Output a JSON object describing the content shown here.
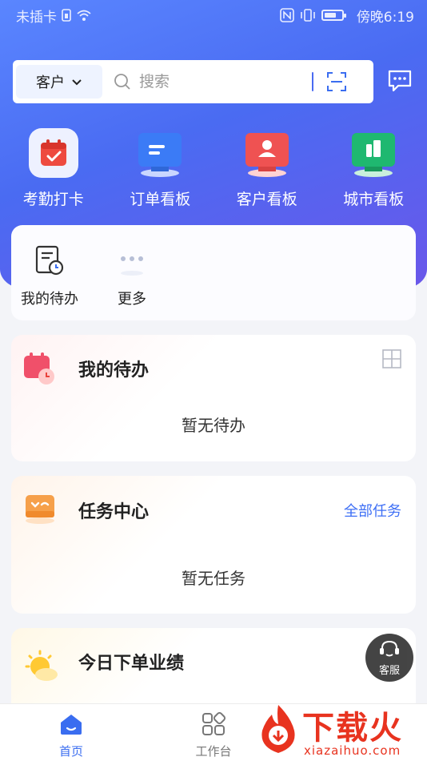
{
  "status_bar": {
    "carrier": "未插卡",
    "time": "傍晚6:19"
  },
  "search": {
    "scope_label": "客户",
    "placeholder": "搜索"
  },
  "quick_actions": [
    {
      "label": "考勤打卡",
      "icon": "calendar-check-icon",
      "color": "#e9423b"
    },
    {
      "label": "订单看板",
      "icon": "order-board-icon",
      "color": "#3b7bf6"
    },
    {
      "label": "客户看板",
      "icon": "customer-board-icon",
      "color": "#ef5252"
    },
    {
      "label": "城市看板",
      "icon": "city-board-icon",
      "color": "#1fb870"
    }
  ],
  "shortcuts": [
    {
      "label": "我的待办",
      "icon": "todo-clock-icon"
    },
    {
      "label": "更多",
      "icon": "more-dots-icon"
    }
  ],
  "todo_section": {
    "title": "我的待办",
    "empty_text": "暂无待办"
  },
  "task_section": {
    "title": "任务中心",
    "link": "全部任务",
    "empty_text": "暂无任务"
  },
  "performance_section": {
    "title": "今日下单业绩"
  },
  "customer_service": {
    "label": "客服"
  },
  "tabbar": {
    "items": [
      {
        "label": "首页",
        "active": true
      },
      {
        "label": "工作台",
        "active": false
      }
    ]
  },
  "watermark": {
    "brand": "下载火",
    "site": "xiazaihuo.com"
  },
  "colors": {
    "primary": "#4a6bf2",
    "accent_link": "#3e6ff5"
  }
}
